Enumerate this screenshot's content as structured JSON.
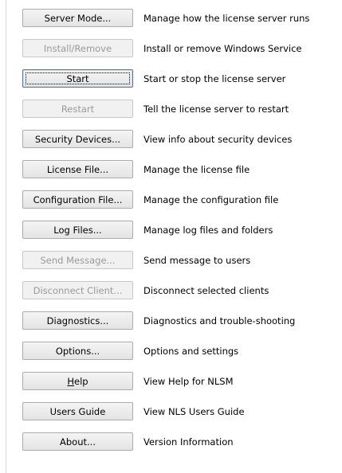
{
  "buttons": [
    {
      "label": "Server Mode...",
      "description": "Manage how the license server runs",
      "enabled": true
    },
    {
      "label": "Install/Remove",
      "description": "Install or remove Windows Service",
      "enabled": false
    },
    {
      "label": "Start",
      "description": "Start or stop the license server",
      "enabled": true,
      "focused": true
    },
    {
      "label": "Restart",
      "description": "Tell the license server to restart",
      "enabled": false
    },
    {
      "label": "Security Devices...",
      "description": "View info about security devices",
      "enabled": true
    },
    {
      "label": "License File...",
      "description": "Manage the license file",
      "enabled": true
    },
    {
      "label": "Configuration File...",
      "description": "Manage the configuration file",
      "enabled": true
    },
    {
      "label": "Log Files...",
      "description": "Manage log files and folders",
      "enabled": true
    },
    {
      "label": "Send Message...",
      "description": "Send message to users",
      "enabled": false
    },
    {
      "label": "Disconnect Client...",
      "description": "Disconnect selected clients",
      "enabled": false
    },
    {
      "label": "Diagnostics...",
      "description": "Diagnostics and trouble-shooting",
      "enabled": true
    },
    {
      "label": "Options...",
      "description": "Options and settings",
      "enabled": true
    },
    {
      "label": "Help",
      "description": "View Help for NLSM",
      "enabled": true,
      "mnemonic": "H"
    },
    {
      "label": "Users Guide",
      "description": "View NLS Users Guide",
      "enabled": true
    },
    {
      "label": "About...",
      "description": "Version Information",
      "enabled": true
    }
  ],
  "colors": {
    "enabled_text": "#000000",
    "disabled_text": "#9a9a9a",
    "button_border": "#acacac",
    "focus_border": "#3c7fb1"
  }
}
